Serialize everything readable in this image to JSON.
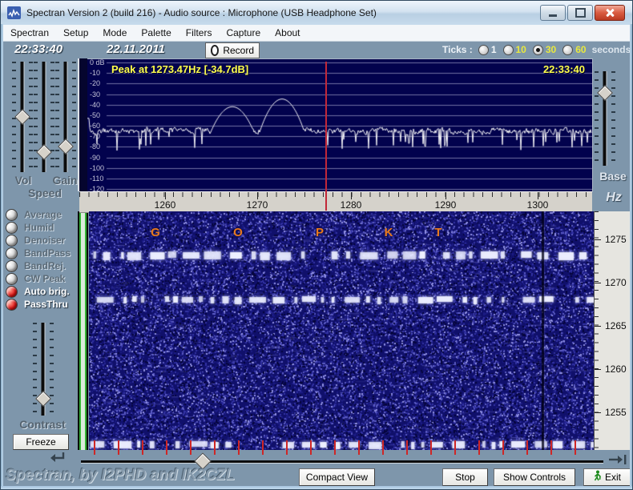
{
  "window": {
    "title": "Spectran Version 2 (build 216) - Audio source :  Microphone (USB Headphone Set)"
  },
  "menu": {
    "items": [
      "Spectran",
      "Setup",
      "Mode",
      "Palette",
      "Filters",
      "Capture",
      "About"
    ]
  },
  "toolbar": {
    "time": "22:33:40",
    "date": "22.11.2011",
    "record_label": "Record",
    "ticks_label": "Ticks :",
    "ticks_options": [
      {
        "label": "1",
        "selected": false,
        "color": "white"
      },
      {
        "label": "10",
        "selected": false,
        "color": "yellow"
      },
      {
        "label": "30",
        "selected": true,
        "color": "yellow"
      },
      {
        "label": "60",
        "selected": false,
        "color": "yellow"
      }
    ],
    "seconds_label": "seconds"
  },
  "spectrum": {
    "peak_readout": "Peak at  1273.47Hz [-34.7dB]",
    "timestamp": "22:33:40",
    "db_labels": [
      "0 dB",
      "-10",
      "-20",
      "-30",
      "-40",
      "-50",
      "-60",
      "-70",
      "-80",
      "-90",
      "-100",
      "-110",
      "-120"
    ],
    "freq_tick_labels": [
      "1260",
      "1270",
      "1280",
      "1290",
      "1300"
    ]
  },
  "waterfall": {
    "decoded_letters": [
      "G",
      "O",
      "P",
      "K",
      "T"
    ]
  },
  "right_panel": {
    "base_label": "Base",
    "hz_label": "Hz",
    "freq_scale_labels": [
      "1275",
      "1270",
      "1265",
      "1260",
      "1255"
    ]
  },
  "left_panel": {
    "vol_label": "Vol",
    "gain_label": "Gain",
    "speed_label": "Speed",
    "contrast_label": "Contrast",
    "freeze_label": "Freeze",
    "toggles": [
      {
        "label": "Average",
        "on": false
      },
      {
        "label": "Humid",
        "on": false
      },
      {
        "label": "Denoiser",
        "on": false
      },
      {
        "label": "BandPass",
        "on": false
      },
      {
        "label": "BandRej.",
        "on": false
      },
      {
        "label": "CW Peak",
        "on": false
      },
      {
        "label": "Auto brig.",
        "on": true
      },
      {
        "label": "PassThru",
        "on": true
      }
    ]
  },
  "bottom_bar": {
    "credit": "Spectran, by I2PHD and IK2CZL",
    "compact_view_label": "Compact View",
    "stop_label": "Stop",
    "show_controls_label": "Show Controls",
    "exit_label": "Exit"
  },
  "colors": {
    "accent_yellow": "#ffff4d",
    "waterfall_letter_orange": "#e8791e",
    "led_red": "#e01818",
    "cursor_red": "#c22838",
    "spectrum_bg": "#02024d"
  },
  "chart_data": {
    "type": "line",
    "title": "Realtime audio spectrum",
    "xlabel": "Hz",
    "ylabel": "dB",
    "x_ticks": [
      1260,
      1270,
      1280,
      1290,
      1300
    ],
    "y_ticks": [
      0,
      -10,
      -20,
      -30,
      -40,
      -50,
      -60,
      -70,
      -80,
      -90,
      -100,
      -110,
      -120
    ],
    "x_range": [
      1252,
      1306
    ],
    "y_range": [
      -120,
      0
    ],
    "peak": {
      "freq_hz": 1273.47,
      "level_db": -34.7
    },
    "secondary_peak": {
      "freq_hz": 1267.5,
      "level_db": -42
    },
    "noise_floor_db": -63,
    "cursor_freq_hz": 1277
  }
}
